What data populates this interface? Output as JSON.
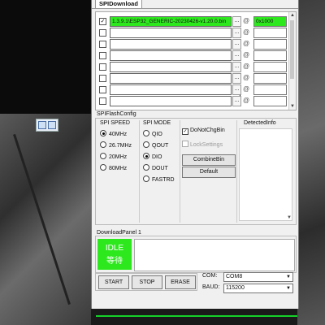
{
  "window": {
    "tab_label": "SPIDownload"
  },
  "files": {
    "rows": [
      {
        "checked": true,
        "path": "1.3.9.1\\ESP32_GENERIC-20230426-v1.20.0.bin",
        "address": "0x1000",
        "browse": "...",
        "at": "@",
        "active": true
      },
      {
        "checked": false,
        "path": "",
        "address": "",
        "browse": "...",
        "at": "@",
        "active": false
      },
      {
        "checked": false,
        "path": "",
        "address": "",
        "browse": "...",
        "at": "@",
        "active": false
      },
      {
        "checked": false,
        "path": "",
        "address": "",
        "browse": "...",
        "at": "@",
        "active": false
      },
      {
        "checked": false,
        "path": "",
        "address": "",
        "browse": "...",
        "at": "@",
        "active": false
      },
      {
        "checked": false,
        "path": "",
        "address": "",
        "browse": "...",
        "at": "@",
        "active": false
      },
      {
        "checked": false,
        "path": "",
        "address": "",
        "browse": "...",
        "at": "@",
        "active": false
      },
      {
        "checked": false,
        "path": "",
        "address": "",
        "browse": "...",
        "at": "@",
        "active": false
      }
    ]
  },
  "spi_flash_config": {
    "title": "SPIFlashConfig",
    "speed": {
      "title": "SPI SPEED",
      "options": [
        "40MHz",
        "26.7MHz",
        "20MHz",
        "80MHz"
      ],
      "selected": "40MHz"
    },
    "mode": {
      "title": "SPI MODE",
      "options": [
        "QIO",
        "QOUT",
        "DIO",
        "DOUT",
        "FASTRD"
      ],
      "selected": "DIO"
    },
    "options": {
      "do_not_chg_bin": {
        "label": "DoNotChgBin",
        "checked": true
      },
      "lock_settings": {
        "label": "LockSettings",
        "checked": false
      },
      "combine_bin_label": "CombineBin",
      "default_label": "Default"
    },
    "detected_info": {
      "title": "DetectedInfo"
    }
  },
  "download_panel": {
    "title": "DownloadPanel 1",
    "status_en": "IDLE",
    "status_cn": "等待"
  },
  "actions": {
    "start": "START",
    "stop": "STOP",
    "erase": "ERASE"
  },
  "port": {
    "com_label": "COM:",
    "com_value": "COM8",
    "baud_label": "BAUD:",
    "baud_value": "115200"
  },
  "colors": {
    "accent_green": "#2ee81e",
    "window_bg": "#f0f0f0"
  }
}
